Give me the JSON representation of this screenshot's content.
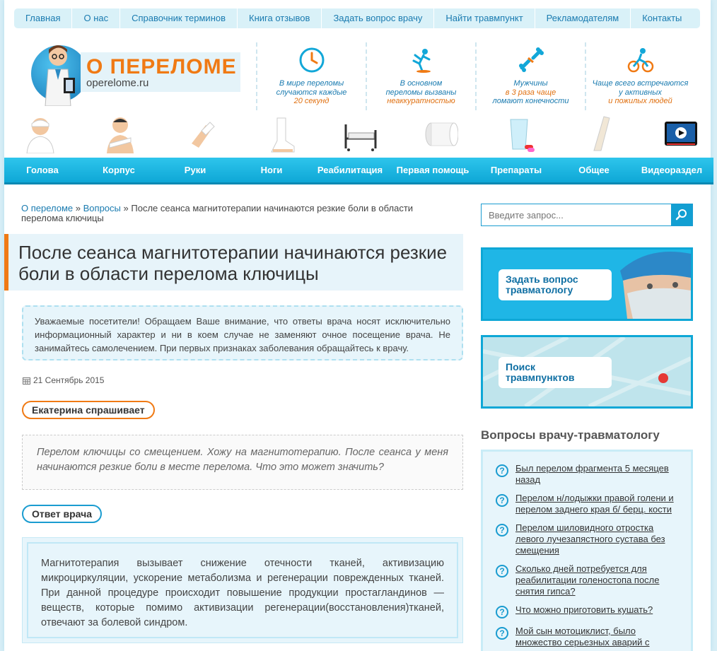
{
  "topnav": [
    "Главная",
    "О нас",
    "Справочник терминов",
    "Книга отзывов",
    "Задать вопрос врачу",
    "Найти травмпункт",
    "Рекламодателям",
    "Контакты"
  ],
  "logo": {
    "title": "О ПЕРЕЛОМЕ",
    "domain": "operelome.ru"
  },
  "facts": [
    {
      "icon": "clock-icon",
      "l1": "В мире переломы",
      "l2": "случаются каждые",
      "l3": "20 секунд"
    },
    {
      "icon": "falling-person-icon",
      "l1": "В основном",
      "l2": "переломы вызваны",
      "l3": "неаккуратностью"
    },
    {
      "icon": "broken-bone-icon",
      "l1": "Мужчины",
      "l2": "в 3 раза чаще",
      "l3": "ломают конечности"
    },
    {
      "icon": "cyclist-icon",
      "l1": "Чаще всего встречаются",
      "l2": "у активных",
      "l3": "и пожилых людей"
    }
  ],
  "categories": [
    "head-bandage-icon",
    "torso-bandage-icon",
    "hand-cast-icon",
    "foot-cast-icon",
    "hospital-bed-icon",
    "bandage-roll-icon",
    "water-pills-icon",
    "leg-splint-icon",
    "video-icon"
  ],
  "menu": [
    "Голова",
    "Корпус",
    "Руки",
    "Ноги",
    "Реабилитация",
    "Первая помощь",
    "Препараты",
    "Общее",
    "Видеораздел"
  ],
  "breadcrumb": {
    "home": "О переломе",
    "sep": "»",
    "section": "Вопросы",
    "current": "После сеанса магнитотерапии начинаются резкие боли в области перелома ключицы"
  },
  "article": {
    "title": "После сеанса магнитотерапии начинаются резкие боли в области перелома ключицы",
    "notice": "Уважаемые посетители! Обращаем Ваше внимание, что ответы врача носят исключительно информационный характер и ни в коем случае не заменяют очное посещение врача. Не занимайтесь самолечением. При первых признаках заболевания обращайтесь к врачу.",
    "date": "21 Сентябрь 2015",
    "asker": "Екатерина спрашивает",
    "question": "Перелом ключицы со смещением. Хожу на магнитотерапию. После сеанса у меня начинаются резкие боли в месте перелома. Что это может значить?",
    "answer_label": "Ответ врача",
    "answer": "Магнитотерапия вызывает снижение отечности тканей, активизацию микроциркуляции, ускорение метаболизма и регенерации поврежденных тканей. При данной процедуре происходит повышение продукции простагландинов — веществ, которые помимо активизации регенерации(восстановления)тканей, отвечают за болевой синдром."
  },
  "search": {
    "placeholder": "Введите запрос..."
  },
  "promo": {
    "ask": "Задать вопрос травматологу",
    "find": "Поиск травмпунктов"
  },
  "sidebar": {
    "title": "Вопросы врачу-травматологу",
    "questions": [
      "Был перелом фрагмента 5 месяцев назад",
      "Перелом н/лодыжки правой голени и перелом заднего края б/ берц. кости",
      "Перелом шиловидного отростка левого лучезапястного сустава без смещения",
      "Сколько дней потребуется для реабилитации голеностопа после снятия гипса?",
      "Что можно приготовить кушать?",
      "Мой сын мотоциклист, было множество серьезных аварий с"
    ]
  },
  "colors": {
    "accent": "#f07a14",
    "brand": "#12a7d8",
    "link": "#1a7bb0"
  }
}
